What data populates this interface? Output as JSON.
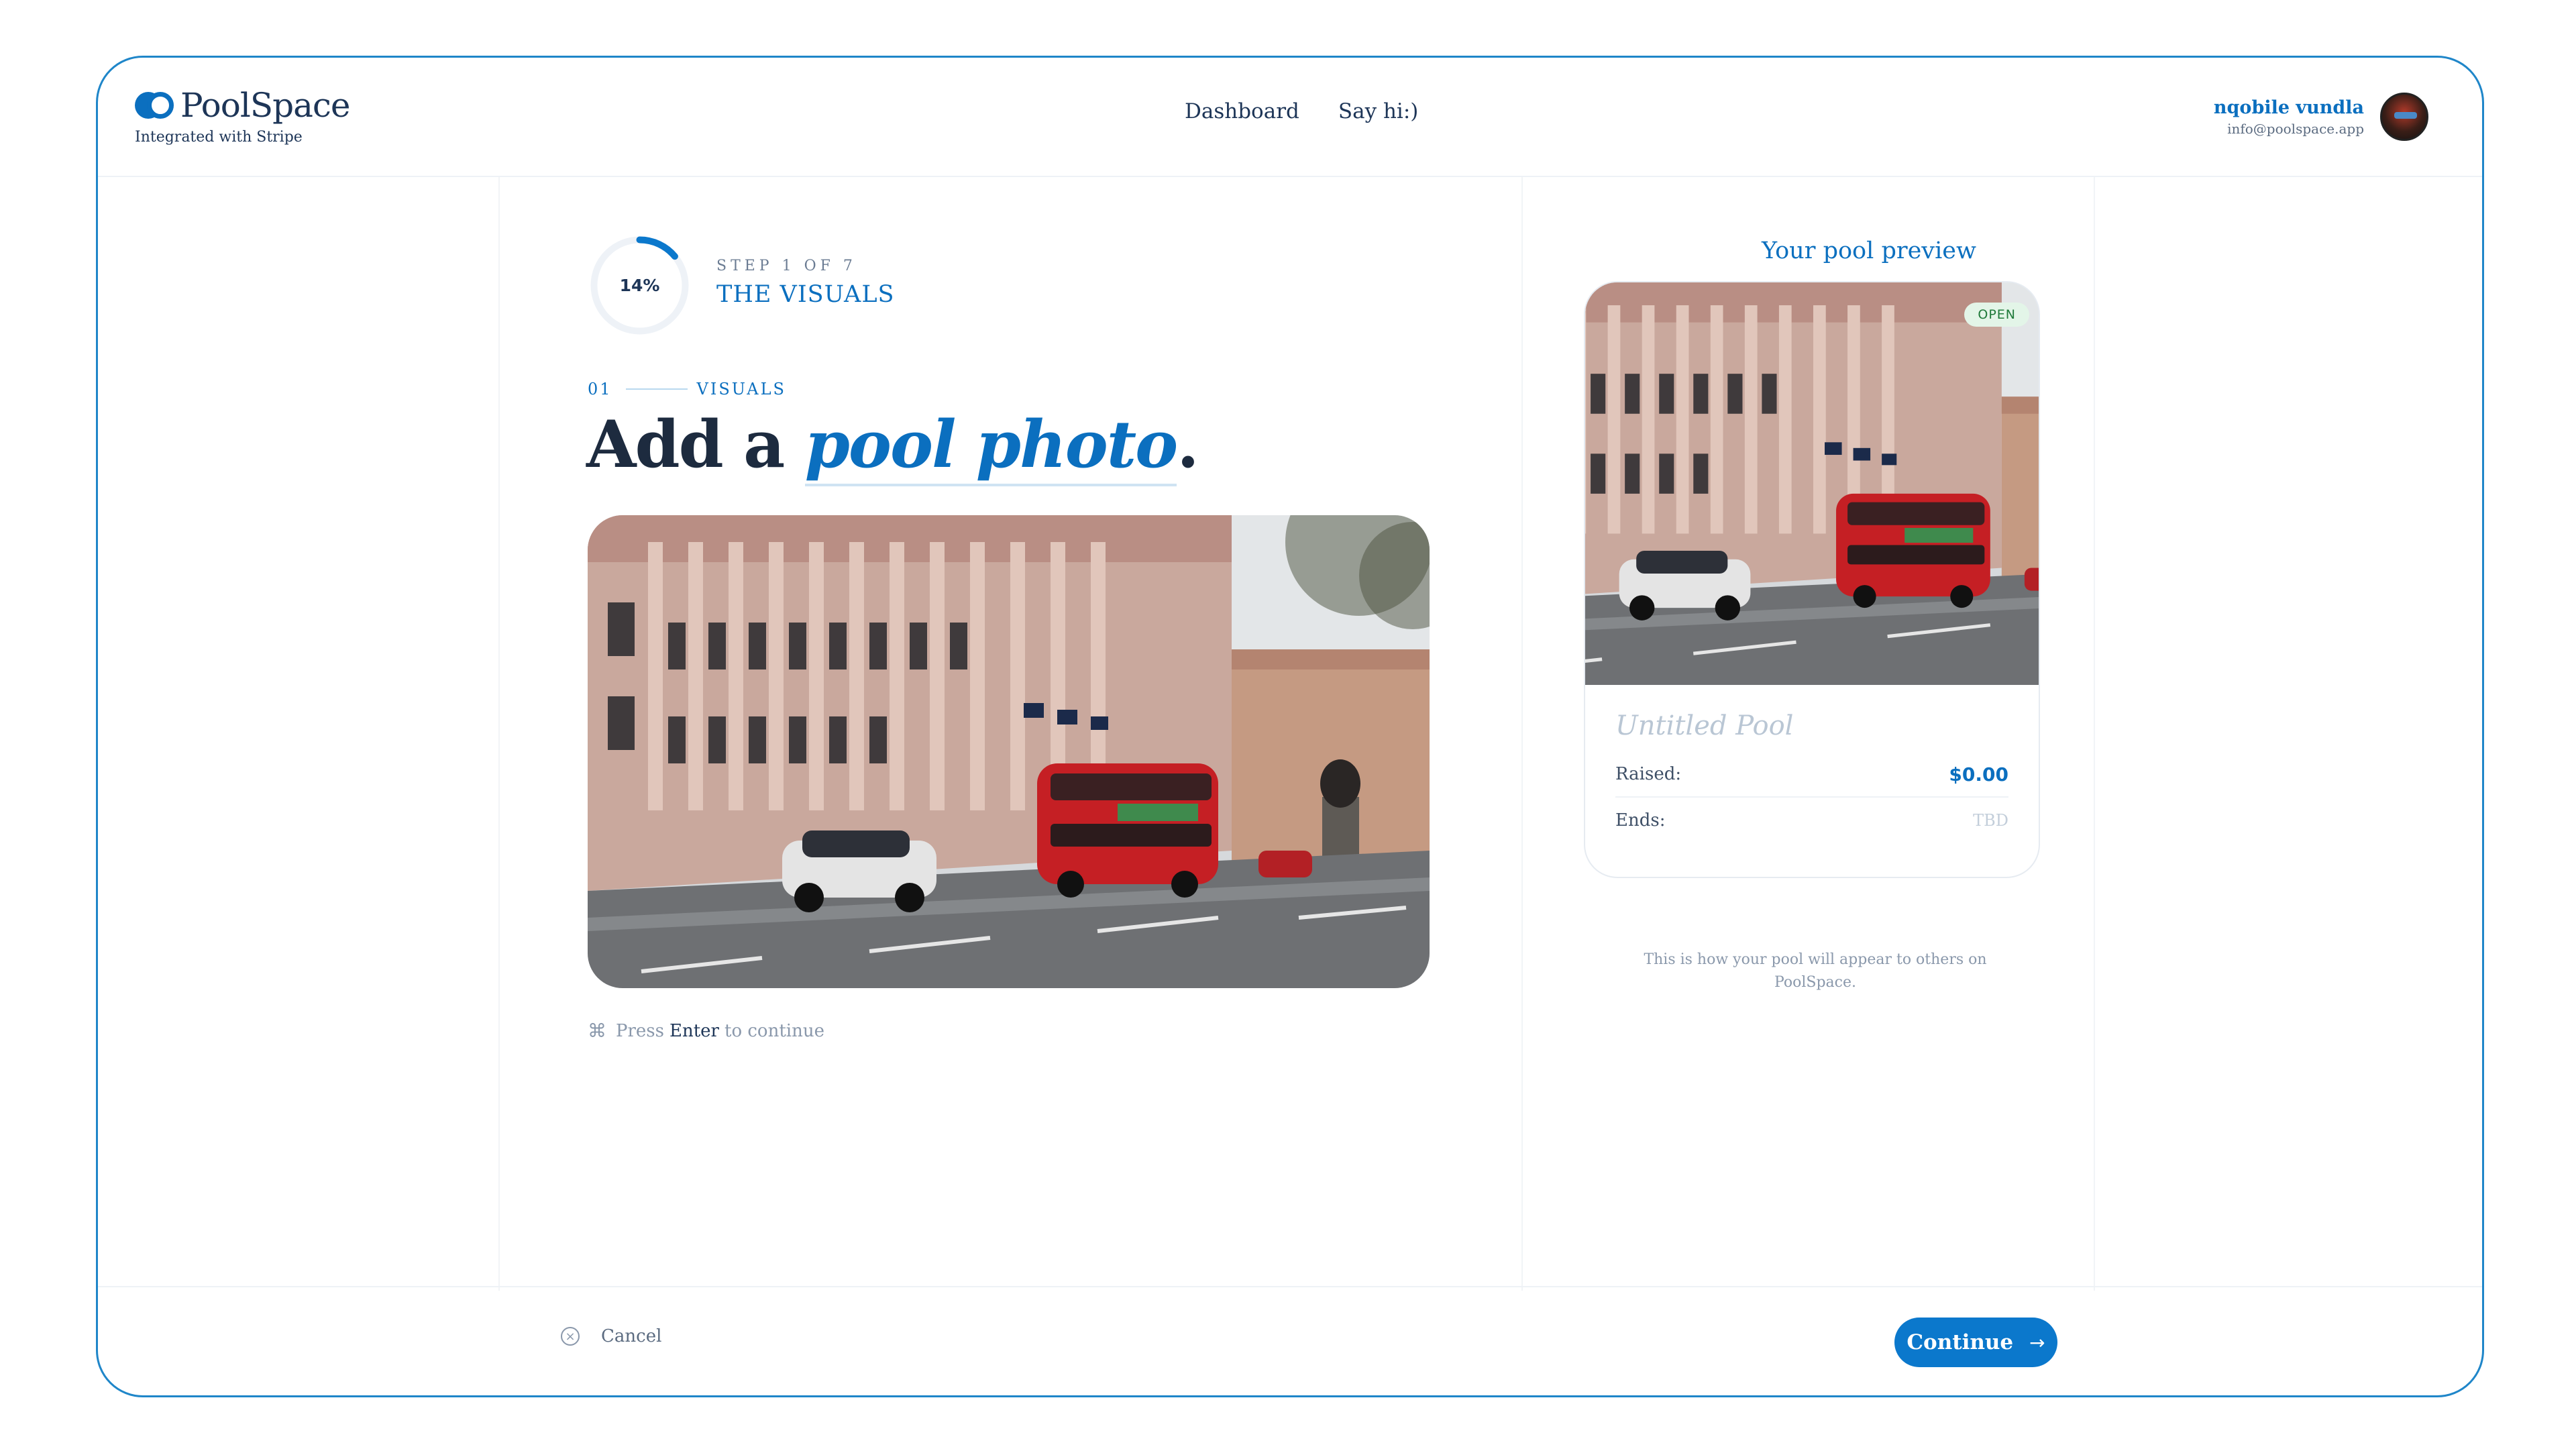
{
  "brand": {
    "name": "PoolSpace",
    "subtitle": "Integrated with Stripe"
  },
  "nav": {
    "items": [
      {
        "label": "Dashboard"
      },
      {
        "label": "Say hi:)"
      }
    ]
  },
  "user": {
    "name": "nqobile vundla",
    "email": "info@poolspace.app"
  },
  "progress": {
    "percent_label": "14%",
    "fraction": 0.14,
    "step_text": "STEP 1 OF 7",
    "step_title": "THE VISUALS"
  },
  "section": {
    "number": "01",
    "label": "VISUALS"
  },
  "headline": {
    "prefix": "Add a ",
    "accent": "pool photo",
    "suffix": "."
  },
  "hint": {
    "before": "Press",
    "key": "Enter",
    "after": "to continue"
  },
  "preview": {
    "title": "Your pool preview",
    "badge": "OPEN",
    "pool_name": "Untitled Pool",
    "raised_label": "Raised:",
    "raised_value": "$0.00",
    "ends_label": "Ends:",
    "ends_value": "TBD",
    "note": "This is how your pool will appear to others on PoolSpace."
  },
  "footer": {
    "cancel_label": "Cancel",
    "continue_label": "Continue"
  },
  "colors": {
    "accent": "#0b78cc",
    "frame": "#1f86c9",
    "text": "#1d3557",
    "muted": "#8a98ab"
  }
}
